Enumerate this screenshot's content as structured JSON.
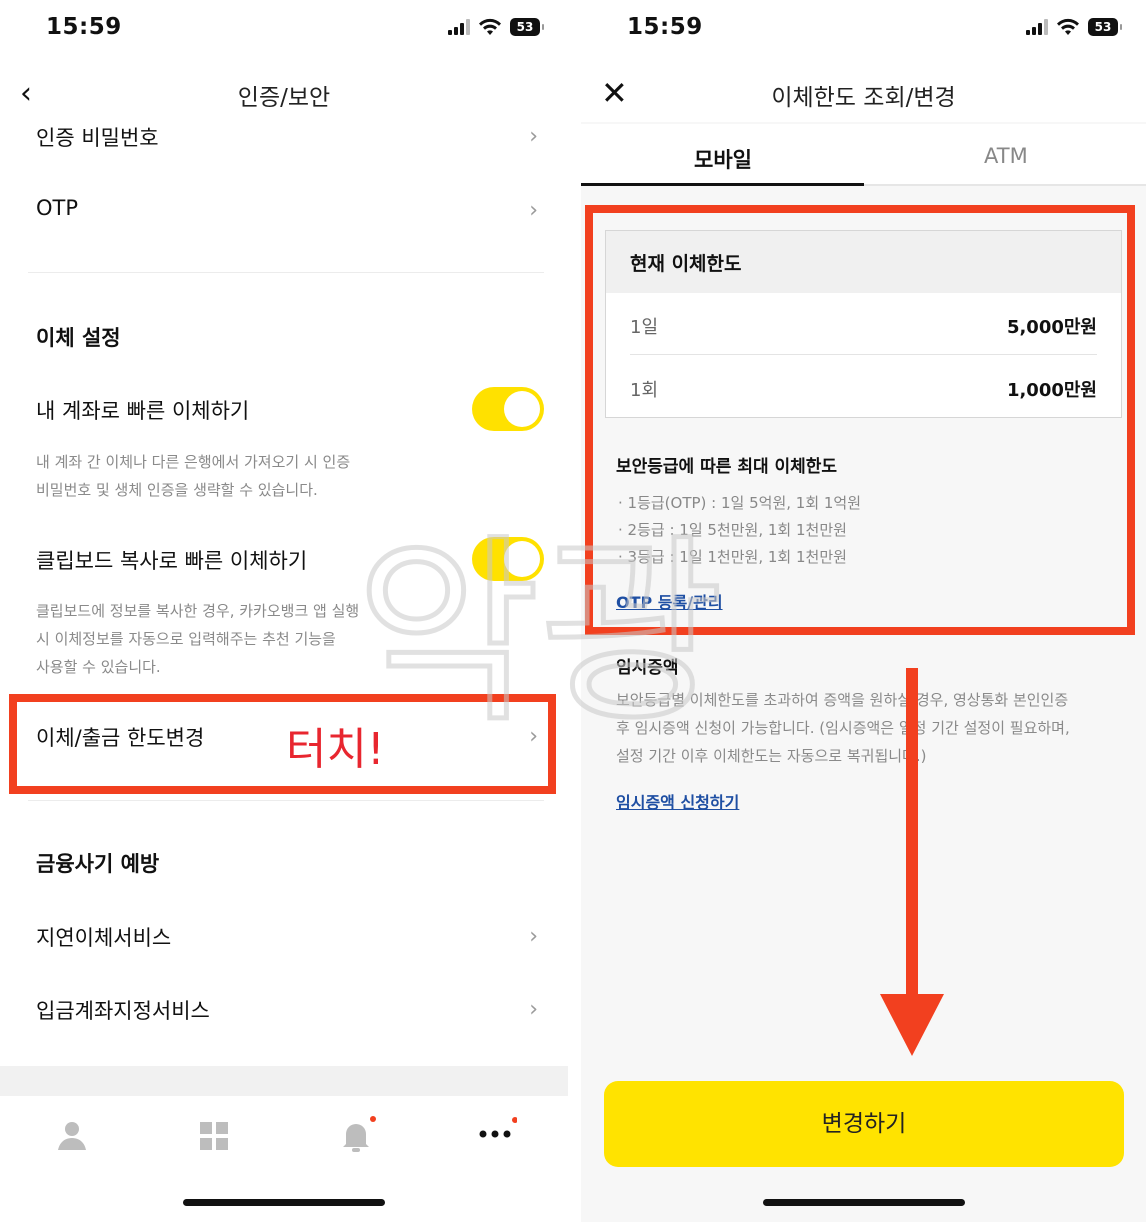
{
  "left": {
    "status_time": "15:59",
    "battery": "53",
    "nav_title": "인증/보안",
    "rows": {
      "auth_pw": "인증 비밀번호",
      "otp": "OTP",
      "quick_own": "내 계좌로 빠른 이체하기",
      "clipboard": "클립보드 복사로 빠른 이체하기",
      "limit_change": "이체/출금 한도변경",
      "delay_service": "지연이체서비스",
      "deposit_account": "입금계좌지정서비스"
    },
    "sections": {
      "transfer_settings": "이체 설정",
      "fraud_prevention": "금융사기 예방"
    },
    "desc_quick_own": [
      "내 계좌 간 이체나 다른 은행에서 가져오기 시 인증",
      "비밀번호 및 생체 인증을 생략할 수 있습니다."
    ],
    "desc_clipboard": [
      "클립보드에 정보를 복사한 경우, 카카오뱅크 앱 실행",
      "시 이체정보를 자동으로 입력해주는 추천 기능을",
      "사용할 수 있습니다."
    ],
    "annotation": "터치!",
    "toggles": {
      "quick_own": true,
      "clipboard": true
    }
  },
  "right": {
    "status_time": "15:59",
    "battery": "53",
    "nav_title": "이체한도 조회/변경",
    "tabs": [
      "모바일",
      "ATM"
    ],
    "active_tab": "모바일",
    "current_limit": {
      "heading": "현재 이체한도",
      "rows": [
        {
          "label": "1일",
          "value": "5,000만원"
        },
        {
          "label": "1회",
          "value": "1,000만원"
        }
      ]
    },
    "security_max": {
      "heading": "보안등급에 따른 최대 이체한도",
      "items": [
        "· 1등급(OTP) : 1일 5억원, 1회 1억원",
        "· 2등급 : 1일 5천만원, 1회 1천만원",
        "· 3등급 : 1일 1천만원, 1회 1천만원"
      ],
      "link": "OTP 등록/관리"
    },
    "temp_increase": {
      "heading": "임시증액",
      "lines": [
        "보안등급별 이체한도를 초과하여 증액을 원하실 경우, 영상통화 본인인증",
        "후 임시증액 신청이 가능합니다. (임시증액은 일정 기간 설정이 필요하며,",
        "설정 기간 이후 이체한도는 자동으로 복귀됩니다.)"
      ],
      "link": "임시증액 신청하기"
    },
    "cta": "변경하기"
  },
  "watermark": "악광",
  "colors": {
    "accent_yellow": "#ffe300",
    "annotation_red": "#f2401f",
    "link_blue": "#1f4fa3"
  }
}
